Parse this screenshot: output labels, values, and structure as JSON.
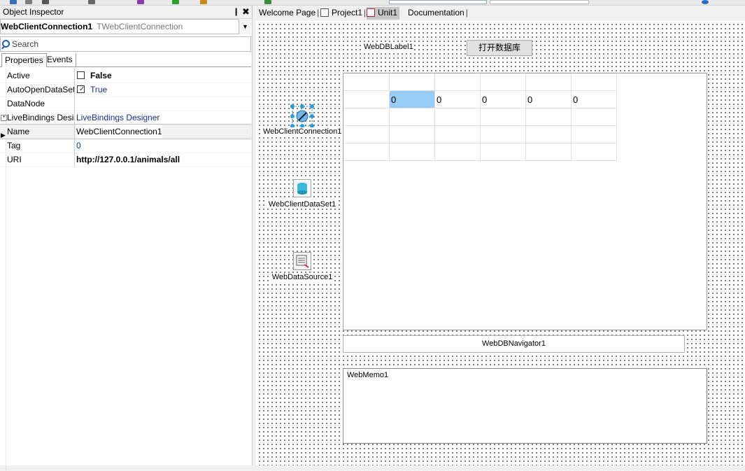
{
  "toolbar": {
    "icons": [
      "save-icon",
      "save-all-icon",
      "open-icon",
      "new-icon",
      "run-icon",
      "debug-icon",
      "step-icon",
      "view-icon",
      "help-icon"
    ]
  },
  "inspector": {
    "title": "Object Inspector",
    "pin": "❙",
    "close": "✖",
    "selected_object": "WebClientConnection1",
    "selected_class": "TWebClientConnection",
    "search_placeholder": "Search",
    "tabs": {
      "properties": "Properties",
      "events": "Events"
    },
    "rows": [
      {
        "key": "Active",
        "value": "False"
      },
      {
        "key": "AutoOpenDataSet",
        "value": "True"
      },
      {
        "key": "DataNode",
        "value": ""
      },
      {
        "key": "LiveBindings Designer",
        "value": "LiveBindings Designer"
      },
      {
        "key": "Name",
        "value": "WebClientConnection1"
      },
      {
        "key": "Tag",
        "value": "0"
      },
      {
        "key": "URI",
        "value": "http://127.0.0.1/animals/all"
      }
    ]
  },
  "designer": {
    "tabs": {
      "welcome": "Welcome Page",
      "project": "Project1",
      "unit": "Unit1",
      "doc": "Documentation"
    },
    "components": {
      "connection": "WebClientConnection1",
      "dataset": "WebClientDataSet1",
      "datasource": "WebDataSource1"
    },
    "label": "WebDBLabel1",
    "button": "打开数据库",
    "grid": {
      "row1": [
        "0",
        "0",
        "0",
        "0",
        "0"
      ]
    },
    "navigator": "WebDBNavigator1",
    "memo": "WebMemo1"
  }
}
